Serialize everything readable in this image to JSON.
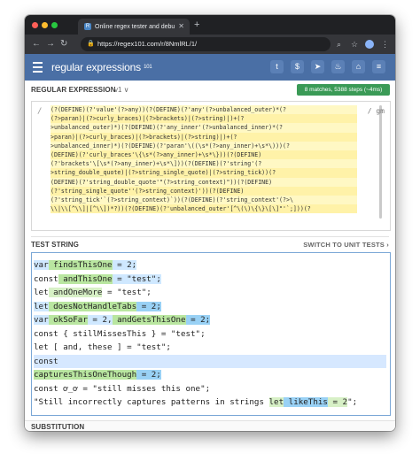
{
  "browser": {
    "tab_title": "Online regex tester and debugg",
    "tab_favicon": "R",
    "url": "https://regex101.com/r/8NmlRL/1/"
  },
  "app": {
    "brand": "regular expressions",
    "brand_sup": "101"
  },
  "header_icons": [
    "twitter-icon",
    "dollar-icon",
    "send-icon",
    "fire-icon",
    "library-icon",
    "menu-icon"
  ],
  "regex_section": {
    "title": "REGULAR EXPRESSION",
    "version": "v1 ∨",
    "match_info": "8 matches, 5388 steps (~4ms)",
    "delimiter_open": "/",
    "delimiter_close": "/",
    "flags": "gm",
    "lines": [
      "(?(DEFINE)(?'value'(?>any))(?(DEFINE)(?'any'(?>unbalanced_outer)*(?",
      "(?>paran)|(?>curly_braces)|(?>brackets)|(?>string)|)+(?",
      ">unbalanced_outer)*)(?(DEFINE)(?'any_inner'(?>unbalanced_inner)*(?",
      ">paran)|(?>curly_braces)|(?>brackets)|(?>string)|)+(?",
      ">unbalanced_inner)*)(?(DEFINE)(?'paran'\\((\\s*(?>any_inner)+\\s*\\)))(?",
      "(DEFINE)(?'curly_braces'\\{\\s*(?>any_inner)+\\s*\\}))(?(DEFINE)",
      "(?'brackets'\\[\\s*(?>any_inner)+\\s*\\]))(?(DEFINE)(?'string'(?",
      ">string_double_quote)|(?>string_single_quote)|(?>string_tick))(?",
      "(DEFINE)(?'string_double_quote'\"(?>string_context)\"))(?(DEFINE)",
      "(?'string_single_quote''(?>string_context)'))(?(DEFINE)",
      "(?'string_tick'`(?>string_context)`))(?(DEFINE)(?'string_context'(?>\\",
      "\\\\|\\\\[^\\\\]|[^\\\\])*?))(?(DEFINE)(?'unbalanced_outer'[^\\(\\)\\{\\}\\[\\]\"'`;]))(?"
    ]
  },
  "test_section": {
    "title": "TEST STRING",
    "switch_label": "SWITCH TO UNIT TESTS ›",
    "lines": [
      [
        {
          "t": "var",
          "c": "m1"
        },
        {
          "t": " findsThisOne",
          "c": "g2"
        },
        {
          "t": " = 2;",
          "c": "m1"
        }
      ],
      [
        {
          "t": "const",
          "c": ""
        },
        {
          "t": " andThisOne",
          "c": "g2"
        },
        {
          "t": " = \"test\";",
          "c": "m1"
        }
      ],
      [
        {
          "t": "let",
          "c": ""
        },
        {
          "t": " andOneMore",
          "c": "m2"
        },
        {
          "t": " = \"test\";",
          "c": ""
        }
      ],
      [
        {
          "t": "let",
          "c": "m1"
        },
        {
          "t": " doesNotHandleTabs",
          "c": "g2"
        },
        {
          "t": " = 2;",
          "c": "g1"
        }
      ],
      [
        {
          "t": "var",
          "c": "m1"
        },
        {
          "t": " okSoFar",
          "c": "g2"
        },
        {
          "t": " = 2,",
          "c": "m1"
        },
        {
          "t": " andGetsThisOne",
          "c": "g2"
        },
        {
          "t": " = 2;",
          "c": "g1"
        }
      ],
      [
        {
          "t": "const { stillMissesThis } = \"test\";",
          "c": ""
        }
      ],
      [
        {
          "t": "let [ and, these ] = \"test\";",
          "c": ""
        }
      ],
      [
        {
          "t": "const",
          "c": ""
        }
      ],
      [
        {
          "t": "capturesThisOneThough",
          "c": "g2"
        },
        {
          "t": " = 2;",
          "c": "g1"
        }
      ],
      [
        {
          "t": "const ơ_ơ = \"still misses this one\";",
          "c": ""
        }
      ],
      [
        {
          "t": "\"Still incorrectly captures patterns in strings ",
          "c": ""
        },
        {
          "t": "let",
          "c": "m2"
        },
        {
          "t": " likeThis",
          "c": "g1"
        },
        {
          "t": " = 2",
          "c": "m2"
        },
        {
          "t": "\";",
          "c": ""
        }
      ]
    ]
  },
  "substitution_section": {
    "title": "SUBSTITUTION"
  }
}
